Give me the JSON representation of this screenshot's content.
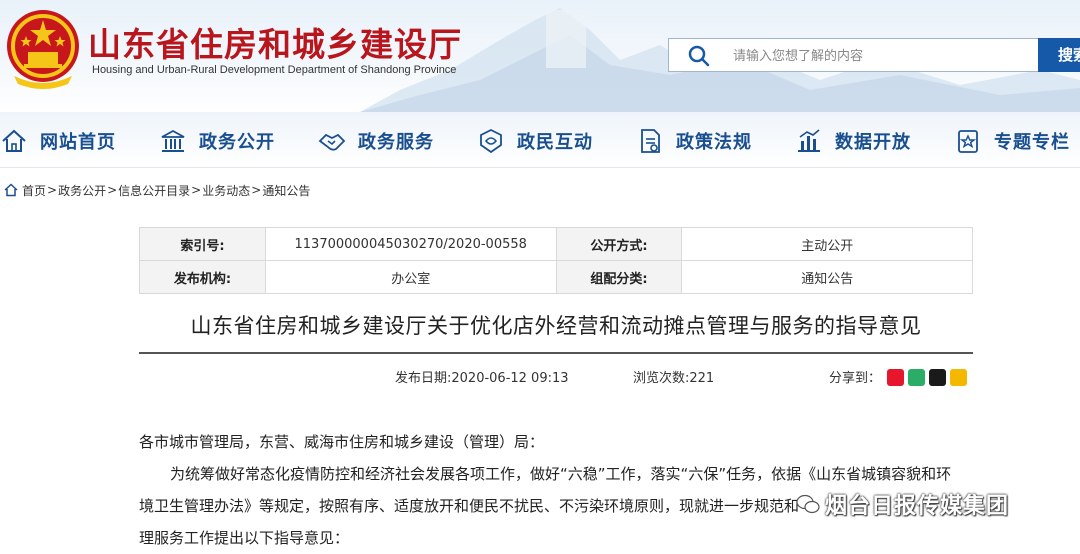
{
  "header": {
    "title": "山东省住房和城乡建设厅",
    "subtitle": "Housing and Urban-Rural Development Department of Shandong Province",
    "search_placeholder": "请输入您想了解的内容",
    "search_button": "搜索",
    "emblem_icon": "national-emblem-icon"
  },
  "nav": {
    "items": [
      {
        "label": "网站首页",
        "icon": "home-icon"
      },
      {
        "label": "政务公开",
        "icon": "building-icon"
      },
      {
        "label": "政务服务",
        "icon": "handshake-icon"
      },
      {
        "label": "政民互动",
        "icon": "interaction-icon"
      },
      {
        "label": "政策法规",
        "icon": "document-icon"
      },
      {
        "label": "数据开放",
        "icon": "chart-icon"
      },
      {
        "label": "专题专栏",
        "icon": "topic-icon"
      }
    ]
  },
  "breadcrumb": {
    "items": [
      "首页",
      "政务公开",
      "信息公开目录",
      "业务动态",
      "通知公告"
    ],
    "separator": ">"
  },
  "meta": {
    "index_label": "索引号:",
    "index_value": "11370000004503027​0/2020-00558",
    "disclosure_label": "公开方式:",
    "disclosure_value": "主动公开",
    "issuer_label": "发布机构:",
    "issuer_value": "办公室",
    "category_label": "组配分类:",
    "category_value": "通知公告"
  },
  "article": {
    "title": "山东省住房和城乡建设厅关于优化店外经营和流动摊点管理与服务的指导意见",
    "publish_date": "发布日期:2020-06-12 09:13",
    "views": "浏览次数:221",
    "share_label": "分享到：",
    "paragraphs": [
      "各市城市管理局，东营、威海市住房和城乡建设（管理）局：",
      "为统筹做好常态化疫情防控和经济社会发展各项工作，做好“六稳”工作，落实“六保”任务，依据《山东省城镇容貌和环",
      "境卫生管理办法》等规定，按照有序、适度放开和便民不扰民、不污染环境原则，现就进一步规范和",
      "理服务工作提出以下指导意见："
    ]
  },
  "share_icons": [
    {
      "name": "weibo-share-icon",
      "color": "#e6162d"
    },
    {
      "name": "wechat-share-icon",
      "color": "#2aae67"
    },
    {
      "name": "qq-share-icon",
      "color": "#1a1a1a"
    },
    {
      "name": "qzone-share-icon",
      "color": "#f5b800"
    }
  ],
  "watermark": {
    "text": "烟台日报传媒集团"
  },
  "colors": {
    "brand_red": "#b8161c",
    "nav_blue": "#1a4f8f",
    "search_button": "#1559a8"
  }
}
